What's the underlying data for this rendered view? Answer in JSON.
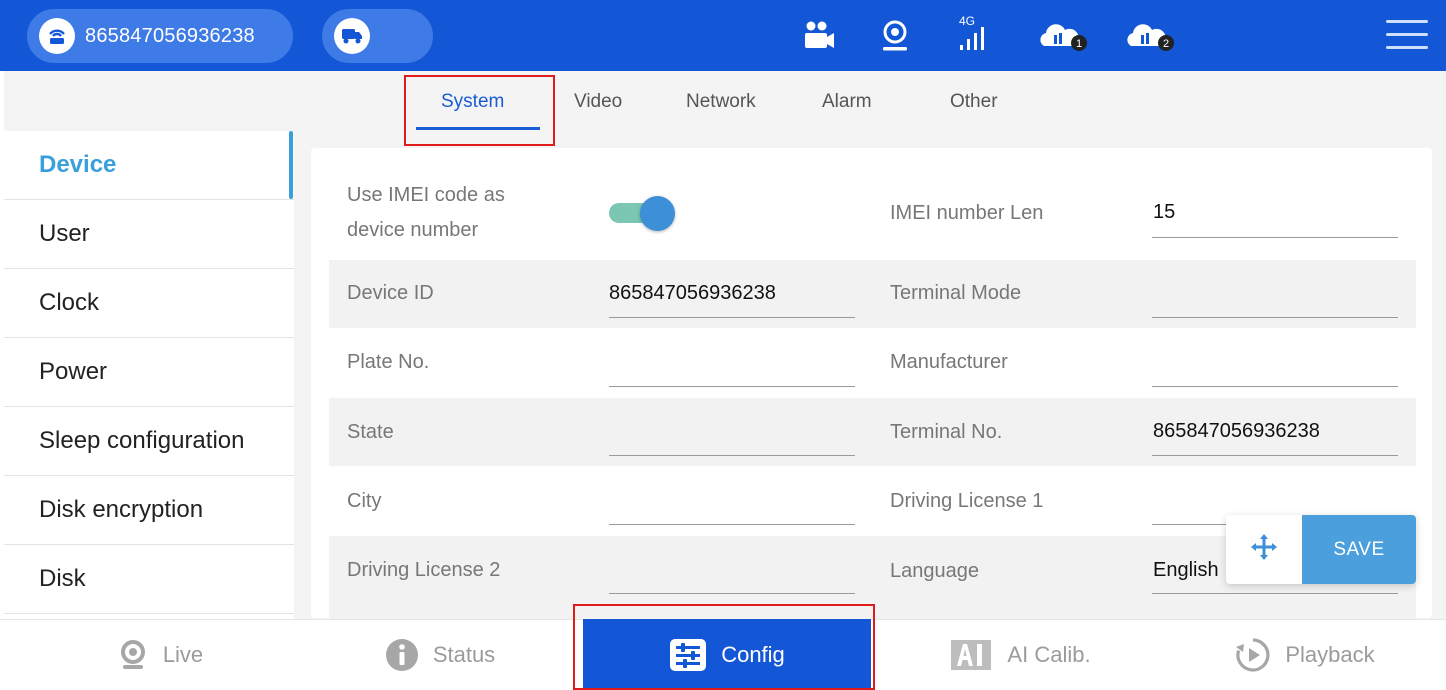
{
  "header": {
    "device_imei": "865847056936238",
    "icons": [
      "router-icon",
      "truck-icon",
      "camera-group-icon",
      "location-icon",
      "signal-4g-icon",
      "cloud-server-1-icon",
      "cloud-server-2-icon",
      "menu-icon"
    ],
    "network_label": "4G",
    "cloud_badges": [
      "1",
      "2"
    ]
  },
  "tabs": [
    {
      "label": "System",
      "active": true
    },
    {
      "label": "Video",
      "active": false
    },
    {
      "label": "Network",
      "active": false
    },
    {
      "label": "Alarm",
      "active": false
    },
    {
      "label": "Other",
      "active": false
    }
  ],
  "sidebar": {
    "items": [
      {
        "label": "Device",
        "active": true
      },
      {
        "label": "User"
      },
      {
        "label": "Clock"
      },
      {
        "label": "Power"
      },
      {
        "label": "Sleep configuration"
      },
      {
        "label": "Disk encryption"
      },
      {
        "label": "Disk"
      }
    ]
  },
  "form": {
    "imei_toggle_label_1": "Use IMEI code as",
    "imei_toggle_label_2": "device number",
    "imei_toggle_on": true,
    "imei_len_label": "IMEI number Len",
    "imei_len_value": "15",
    "device_id_label": "Device ID",
    "device_id_value": "865847056936238",
    "terminal_mode_label": "Terminal Mode",
    "terminal_mode_value": "",
    "plate_label": "Plate No.",
    "plate_value": "",
    "manufacturer_label": "Manufacturer",
    "manufacturer_value": "",
    "state_label": "State",
    "state_value": "",
    "terminal_no_label": "Terminal No.",
    "terminal_no_value": "865847056936238",
    "city_label": "City",
    "city_value": "",
    "dl1_label": "Driving License 1",
    "dl1_value": "",
    "dl2_label": "Driving License 2",
    "dl2_value": "",
    "language_label": "Language",
    "language_value": "English"
  },
  "actions": {
    "save_label": "SAVE"
  },
  "bottom_nav": [
    {
      "label": "Live"
    },
    {
      "label": "Status"
    },
    {
      "label": "Config",
      "active": true
    },
    {
      "label": "AI Calib."
    },
    {
      "label": "Playback"
    }
  ],
  "colors": {
    "primary": "#1457d6",
    "accent": "#3aa0dc",
    "highlight": "#e01b1b"
  }
}
